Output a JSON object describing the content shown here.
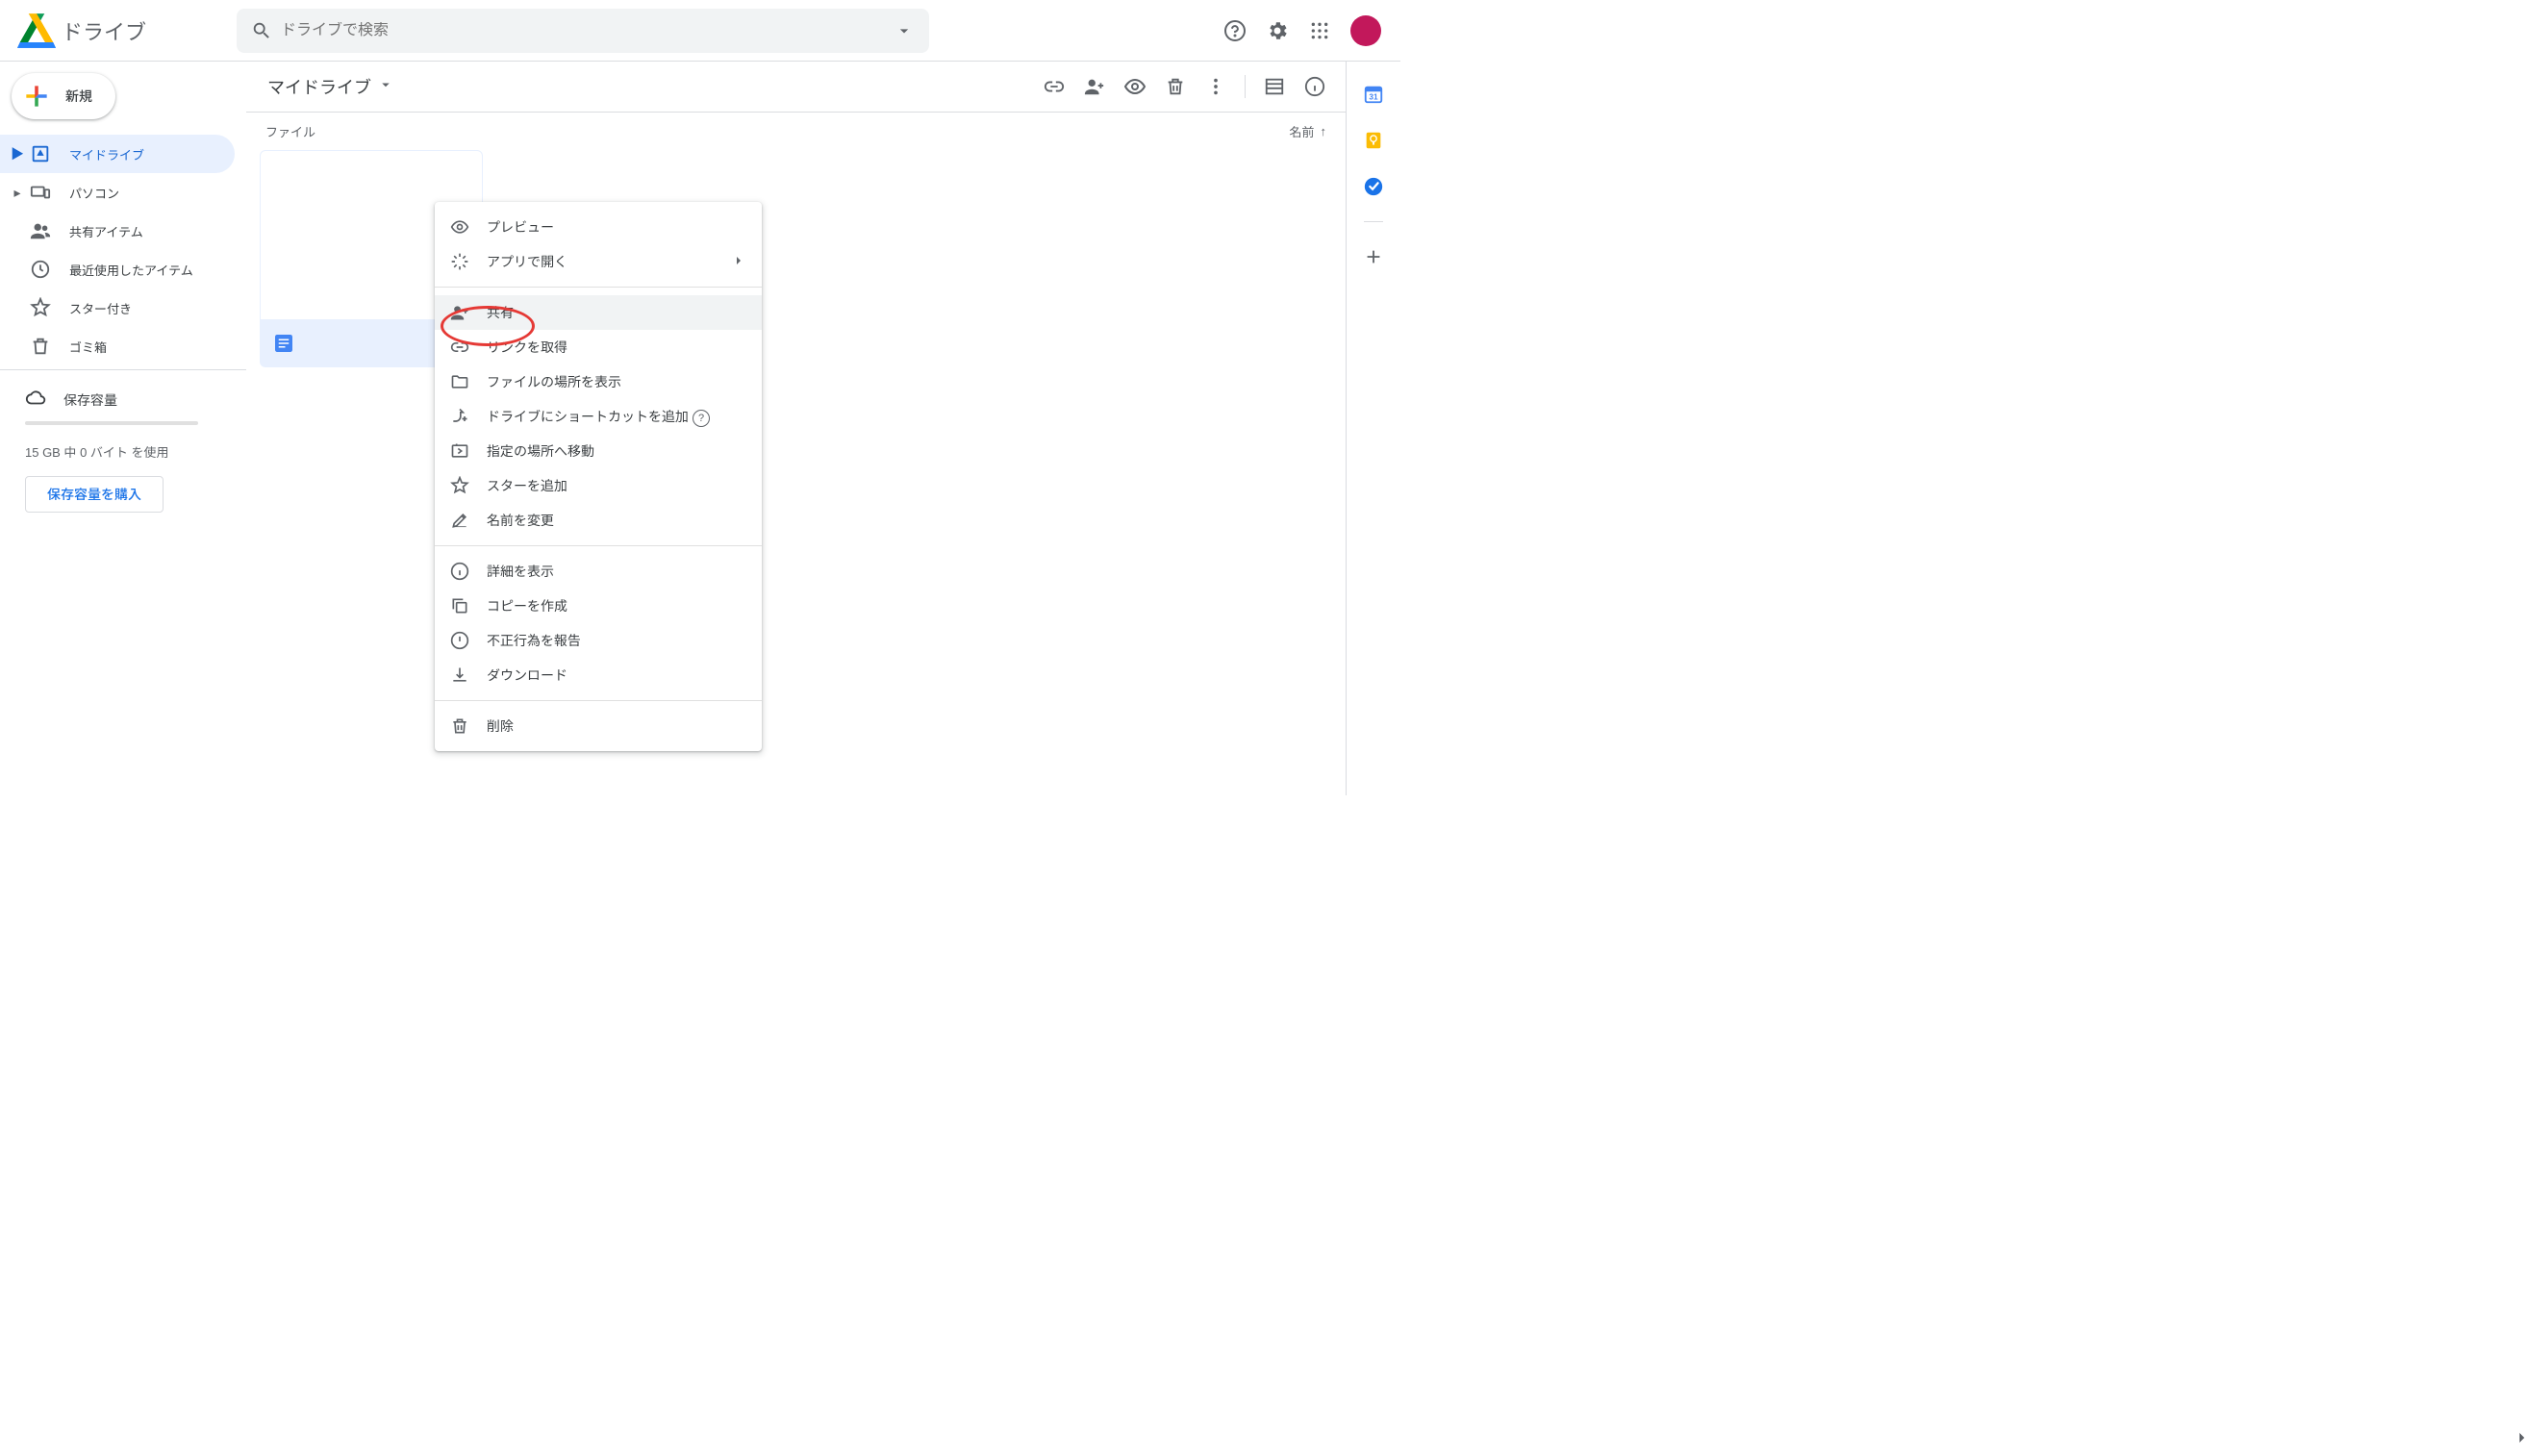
{
  "brand": {
    "name": "ドライブ"
  },
  "search": {
    "placeholder": "ドライブで検索"
  },
  "new_button": {
    "label": "新規"
  },
  "sidebar": {
    "items": [
      {
        "label": "マイドライブ",
        "active": true,
        "has_caret": true
      },
      {
        "label": "パソコン",
        "active": false,
        "has_caret": true
      },
      {
        "label": "共有アイテム",
        "active": false,
        "has_caret": false
      },
      {
        "label": "最近使用したアイテム",
        "active": false,
        "has_caret": false
      },
      {
        "label": "スター付き",
        "active": false,
        "has_caret": false
      },
      {
        "label": "ゴミ箱",
        "active": false,
        "has_caret": false
      }
    ],
    "storage_label": "保存容量",
    "storage_text": "15 GB 中 0 バイト を使用",
    "buy_label": "保存容量を購入"
  },
  "colors": {
    "accent": "#1a73e8",
    "avatar": "#c2185b"
  },
  "main": {
    "breadcrumb": "マイドライブ",
    "section_label": "ファイル",
    "sort_label": "名前",
    "file": {
      "name": ""
    }
  },
  "context_menu": {
    "highlighted_index": 2,
    "groups": [
      [
        {
          "icon": "eye",
          "label": "プレビュー"
        },
        {
          "icon": "open-with",
          "label": "アプリで開く",
          "submenu": true
        }
      ],
      [
        {
          "icon": "person-add",
          "label": "共有"
        },
        {
          "icon": "link",
          "label": "リンクを取得"
        },
        {
          "icon": "folder",
          "label": "ファイルの場所を表示"
        },
        {
          "icon": "shortcut",
          "label": "ドライブにショートカットを追加",
          "help": true
        },
        {
          "icon": "move",
          "label": "指定の場所へ移動"
        },
        {
          "icon": "star",
          "label": "スターを追加"
        },
        {
          "icon": "rename",
          "label": "名前を変更"
        }
      ],
      [
        {
          "icon": "info",
          "label": "詳細を表示"
        },
        {
          "icon": "copy",
          "label": "コピーを作成"
        },
        {
          "icon": "report",
          "label": "不正行為を報告"
        },
        {
          "icon": "download",
          "label": "ダウンロード"
        }
      ],
      [
        {
          "icon": "trash",
          "label": "削除"
        }
      ]
    ]
  }
}
